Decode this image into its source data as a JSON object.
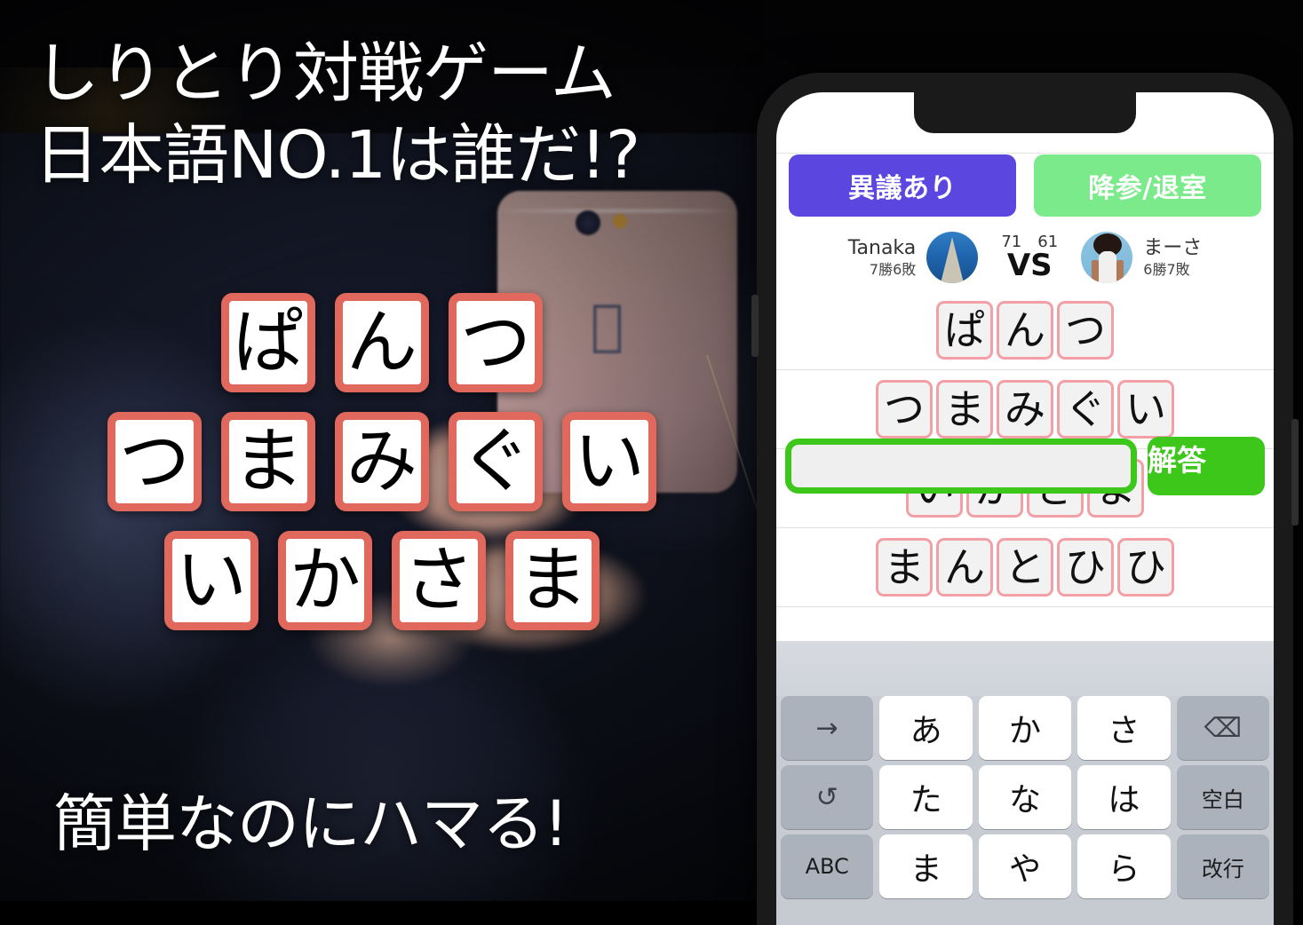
{
  "promo": {
    "headline_line1": "しりとり対戦ゲーム",
    "headline_line2": "日本語NO.1は誰だ!?",
    "footer": "簡単なのにハマる!",
    "tile_border_color": "#E0685C"
  },
  "showcase": {
    "rows": [
      {
        "letters": [
          "ぱ",
          "ん",
          "つ"
        ]
      },
      {
        "letters": [
          "つ",
          "ま",
          "み",
          "ぐ",
          "い"
        ]
      },
      {
        "letters": [
          "い",
          "か",
          "さ",
          "ま"
        ]
      }
    ]
  },
  "app": {
    "actions": {
      "objection_label": "異議あり",
      "objection_color": "#5B47E0",
      "surrender_label": "降参/退室",
      "surrender_color": "#7BEA8A"
    },
    "versus": {
      "left_player": {
        "name": "Tanaka",
        "record": "7勝6敗",
        "score": "71",
        "avatar": "tower-avatar"
      },
      "right_player": {
        "name": "まーさ",
        "record": "6勝7敗",
        "score": "61",
        "avatar": "woman-avatar"
      },
      "vs_label": "VS"
    },
    "words": [
      {
        "letters": [
          "ぱ",
          "ん",
          "つ"
        ]
      },
      {
        "letters": [
          "つ",
          "ま",
          "み",
          "ぐ",
          "い"
        ]
      },
      {
        "letters": [
          "い",
          "か",
          "さ",
          "ま"
        ]
      },
      {
        "letters": [
          "ま",
          "ん",
          "と",
          "ひ",
          "ひ"
        ]
      }
    ],
    "answer": {
      "input_value": "",
      "input_placeholder": "",
      "submit_label": "解答",
      "accent_color": "#3CC71A"
    },
    "keyboard": {
      "rows": [
        [
          {
            "label": "→",
            "type": "fn",
            "icon": "arrow-right-icon"
          },
          {
            "label": "あ",
            "type": "key"
          },
          {
            "label": "か",
            "type": "key"
          },
          {
            "label": "さ",
            "type": "key"
          },
          {
            "label": "⌫",
            "type": "fn",
            "icon": "backspace-icon"
          }
        ],
        [
          {
            "label": "↺",
            "type": "fn",
            "icon": "undo-icon"
          },
          {
            "label": "た",
            "type": "key"
          },
          {
            "label": "な",
            "type": "key"
          },
          {
            "label": "は",
            "type": "key"
          },
          {
            "label": "空白",
            "type": "fn"
          }
        ],
        [
          {
            "label": "ABC",
            "type": "fn"
          },
          {
            "label": "ま",
            "type": "key"
          },
          {
            "label": "や",
            "type": "key"
          },
          {
            "label": "ら",
            "type": "key"
          },
          {
            "label": "改行",
            "type": "fn"
          }
        ]
      ]
    }
  }
}
